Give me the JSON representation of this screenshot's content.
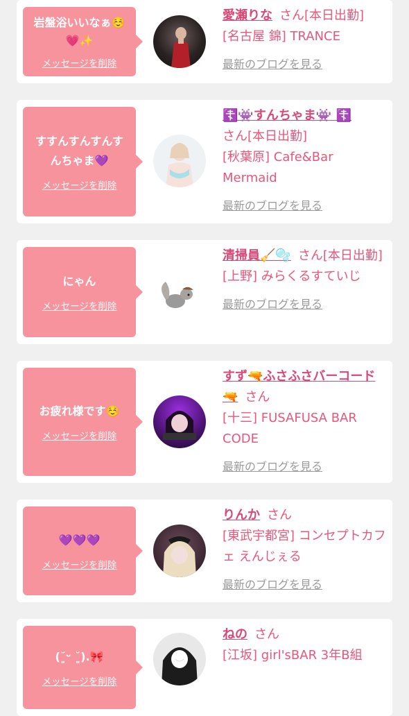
{
  "delete_label": "メッセージを削除",
  "blog_label": "最新のブログを見る",
  "san": "さん",
  "cards": [
    {
      "message": "岩盤浴いいなぁ☺️💗✨",
      "name": "愛瀬りな",
      "status": "[本日出勤]",
      "shop": "[名古屋 錦] TRANCE"
    },
    {
      "message": "すすんすんすんすんちゃま💜",
      "name": "☦️👾すんちゃま👾 ☦️",
      "status": "[本日出勤]",
      "shop": "[秋葉原] Cafe&Bar Mermaid"
    },
    {
      "message": "にゃん",
      "name": "清掃員🧹🫧",
      "status": "[本日出勤]",
      "shop": "[上野] みらくるすていじ"
    },
    {
      "message": "お疲れ様です☺️",
      "name": "すず🔫ふさふさバーコード🔫",
      "status": "",
      "shop": "[十三] FUSAFUSA BAR CODE"
    },
    {
      "message": "💜💜💜",
      "name": "りんか",
      "status": "",
      "shop": "[東武宇都宮] コンセプトカフェ えんじぇる"
    },
    {
      "message": "(˘͈ᵕ ˘͈).🎀",
      "name": "ねの",
      "status": "",
      "shop": "[江坂] girl'sBAR 3年B組"
    }
  ]
}
